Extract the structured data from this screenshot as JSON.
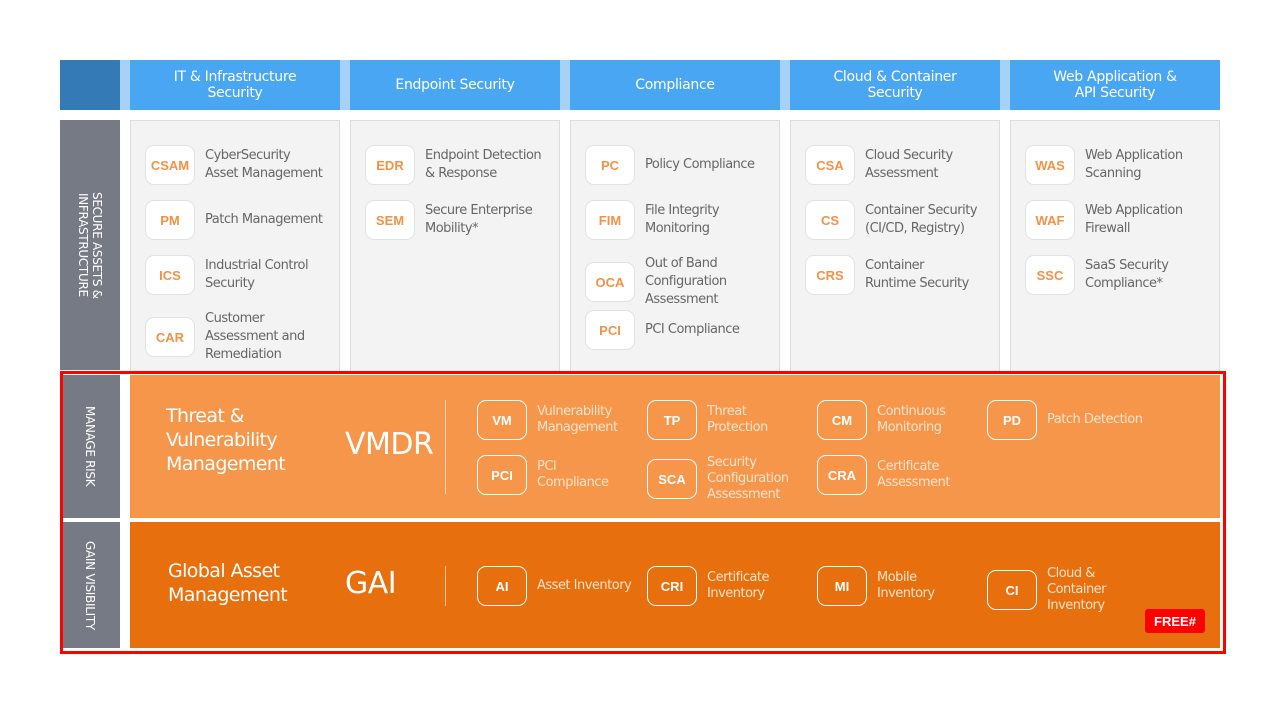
{
  "columns": [
    {
      "title": "IT & Infrastructure\nSecurity",
      "items": [
        {
          "abbr": "CSAM",
          "label": "CyberSecurity\nAsset Management"
        },
        {
          "abbr": "PM",
          "label": "Patch Management"
        },
        {
          "abbr": "ICS",
          "label": "Industrial Control\nSecurity"
        },
        {
          "abbr": "CAR",
          "label": "Customer\nAssessment and\nRemediation"
        }
      ]
    },
    {
      "title": "Endpoint Security",
      "items": [
        {
          "abbr": "EDR",
          "label": "Endpoint Detection\n& Response"
        },
        {
          "abbr": "SEM",
          "label": "Secure Enterprise\nMobility*"
        }
      ]
    },
    {
      "title": "Compliance",
      "items": [
        {
          "abbr": "PC",
          "label": "Policy Compliance"
        },
        {
          "abbr": "FIM",
          "label": "File Integrity\nMonitoring"
        },
        {
          "abbr": "OCA",
          "label": "Out of Band\nConfiguration\nAssessment"
        },
        {
          "abbr": "PCI",
          "label": "PCI Compliance"
        }
      ]
    },
    {
      "title": "Cloud & Container\nSecurity",
      "items": [
        {
          "abbr": "CSA",
          "label": "Cloud Security\nAssessment"
        },
        {
          "abbr": "CS",
          "label": "Container Security\n(CI/CD, Registry)"
        },
        {
          "abbr": "CRS",
          "label": "Container\nRuntime Security"
        }
      ]
    },
    {
      "title": "Web Application &\nAPI Security",
      "items": [
        {
          "abbr": "WAS",
          "label": "Web Application\nScanning"
        },
        {
          "abbr": "WAF",
          "label": "Web Application\nFirewall"
        },
        {
          "abbr": "SSC",
          "label": "SaaS Security\nCompliance*"
        }
      ]
    }
  ],
  "rows": {
    "secure": {
      "label": "SECURE ASSETS &\nINFRASTRUCTURE"
    },
    "manage_risk": {
      "label": "MANAGE RISK"
    },
    "gain_visibility": {
      "label": "GAIN VISIBILITY"
    }
  },
  "vmdr": {
    "title": "Threat &\nVulnerability\nManagement",
    "abbr": "VMDR",
    "items": [
      {
        "abbr": "VM",
        "label": "Vulnerability\nManagement"
      },
      {
        "abbr": "TP",
        "label": "Threat\nProtection"
      },
      {
        "abbr": "CM",
        "label": "Continuous\nMonitoring"
      },
      {
        "abbr": "PD",
        "label": "Patch Detection"
      },
      {
        "abbr": "PCI",
        "label": "PCI\nCompliance"
      },
      {
        "abbr": "SCA",
        "label": "Security\nConfiguration\nAssessment"
      },
      {
        "abbr": "CRA",
        "label": "Certificate\nAssessment"
      }
    ]
  },
  "gai": {
    "title": "Global Asset\nManagement",
    "abbr": "GAI",
    "items": [
      {
        "abbr": "AI",
        "label": "Asset Inventory"
      },
      {
        "abbr": "CRI",
        "label": "Certificate\nInventory"
      },
      {
        "abbr": "MI",
        "label": "Mobile\nInventory"
      },
      {
        "abbr": "CI",
        "label": "Cloud &\nContainer\nInventory"
      }
    ],
    "badge": "FREE#"
  },
  "colors": {
    "header_blue": "#49a6f2",
    "corner_blue": "#337ab7",
    "side_gray": "#767a84",
    "vmdr_orange": "#f5964a",
    "gai_orange": "#e76f0e",
    "highlight_red": "#ff0000",
    "abbr_orange": "#f39247"
  }
}
